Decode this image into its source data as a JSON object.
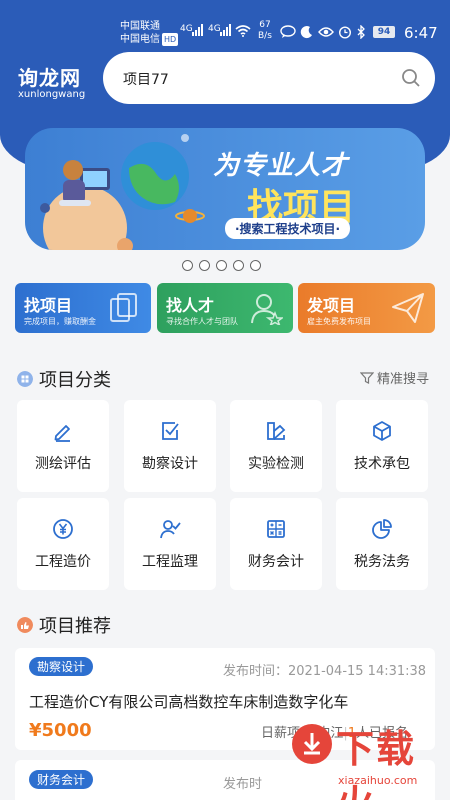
{
  "status_bar": {
    "carrier1": "中国联通",
    "carrier2": "中国电信",
    "hd": "HD",
    "net1": "4G",
    "net2": "4G",
    "speed_value": "67",
    "speed_unit": "B/s",
    "battery": "94",
    "time": "6:47"
  },
  "header": {
    "logo_cn": "询龙网",
    "logo_en": "xunlongwang",
    "search_value": "项目77"
  },
  "banner": {
    "title_line1": "为专业人才",
    "title_line2": "找项目",
    "subtitle": "·搜索工程技术项目·",
    "page_count": 5
  },
  "actions": [
    {
      "title": "找项目",
      "subtitle": "完成项目，赚取酬金"
    },
    {
      "title": "找人才",
      "subtitle": "寻找合作人才与团队"
    },
    {
      "title": "发项目",
      "subtitle": "雇主免费发布项目"
    }
  ],
  "categories_section": {
    "title": "项目分类",
    "filter_label": "精准搜寻",
    "items": [
      {
        "label": "测绘评估",
        "icon": "pencil-icon"
      },
      {
        "label": "勘察设计",
        "icon": "checkbox-icon"
      },
      {
        "label": "实验检测",
        "icon": "flask-icon"
      },
      {
        "label": "技术承包",
        "icon": "cube-icon"
      },
      {
        "label": "工程造价",
        "icon": "yen-icon"
      },
      {
        "label": "工程监理",
        "icon": "supervisor-icon"
      },
      {
        "label": "财务会计",
        "icon": "calculator-icon"
      },
      {
        "label": "税务法务",
        "icon": "pie-chart-icon"
      }
    ]
  },
  "recommend_section": {
    "title": "项目推荐",
    "projects": [
      {
        "tag": "勘察设计",
        "publish_time": "发布时间：2021-04-15 14:31:38",
        "title": "工程造价CY有限公司高档数控车床制造数字化车",
        "price": "¥5000",
        "pay_type": "日薪项目",
        "location": "内江",
        "signup_count": "1",
        "signup_label": "人已报名"
      },
      {
        "tag": "财务会计",
        "publish_time": "发布时"
      }
    ]
  },
  "watermark": {
    "text": "下载火",
    "sub": "xiazaihuo.com"
  },
  "colors": {
    "primary": "#2b5cb8",
    "green": "#2ea05e",
    "orange": "#ea7b2a",
    "price": "#f07a1c"
  }
}
